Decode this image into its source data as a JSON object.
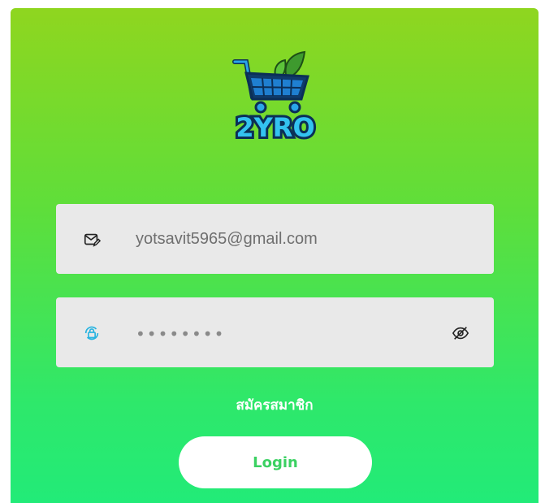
{
  "brand": {
    "logo_text": "2YRO",
    "accent": "#3bd162",
    "gradient_top": "#8fd61f",
    "gradient_bottom": "#22eb78"
  },
  "email_field": {
    "icon": "mail-edit-icon",
    "value": "yotsavit5965@gmail.com"
  },
  "password_field": {
    "icon": "lock-icon",
    "masked_value": "••••••••",
    "toggle_icon": "eye-off-icon"
  },
  "register_link": "สมัครสมาชิก",
  "login_button": "Login"
}
